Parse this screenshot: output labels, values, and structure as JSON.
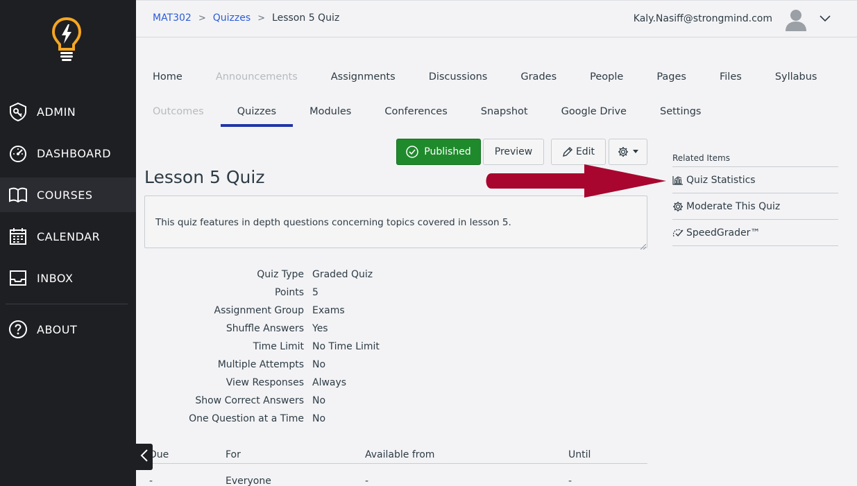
{
  "sidebar": {
    "items": [
      {
        "label": "ADMIN",
        "icon": "shield-key-icon"
      },
      {
        "label": "DASHBOARD",
        "icon": "speedometer-icon"
      },
      {
        "label": "COURSES",
        "icon": "book-icon"
      },
      {
        "label": "CALENDAR",
        "icon": "calendar-icon"
      },
      {
        "label": "INBOX",
        "icon": "inbox-icon"
      },
      {
        "label": "ABOUT",
        "icon": "question-circle-icon"
      }
    ],
    "active": "COURSES"
  },
  "breadcrumb": {
    "course": "MAT302",
    "section": "Quizzes",
    "current": "Lesson 5 Quiz"
  },
  "user": {
    "email": "Kaly.Nasiff@strongmind.com"
  },
  "tabs_row1": [
    "Home",
    "Announcements",
    "Assignments",
    "Discussions",
    "Grades",
    "People",
    "Pages",
    "Files",
    "Syllabus"
  ],
  "tabs_row2": [
    "Outcomes",
    "Quizzes",
    "Modules",
    "Conferences",
    "Snapshot",
    "Google Drive",
    "Settings"
  ],
  "toolbar": {
    "published_label": "Published",
    "preview_label": "Preview",
    "edit_label": "Edit"
  },
  "quiz": {
    "title": "Lesson 5 Quiz",
    "description": "This quiz features in depth questions concerning topics covered in lesson 5.",
    "details": [
      {
        "label": "Quiz Type",
        "value": "Graded Quiz"
      },
      {
        "label": "Points",
        "value": "5"
      },
      {
        "label": "Assignment Group",
        "value": "Exams"
      },
      {
        "label": "Shuffle Answers",
        "value": "Yes"
      },
      {
        "label": "Time Limit",
        "value": "No Time Limit"
      },
      {
        "label": "Multiple Attempts",
        "value": "No"
      },
      {
        "label": "View Responses",
        "value": "Always"
      },
      {
        "label": "Show Correct Answers",
        "value": "No"
      },
      {
        "label": "One Question at a Time",
        "value": "No"
      }
    ]
  },
  "due_table": {
    "headers": [
      "Due",
      "For",
      "Available from",
      "Until"
    ],
    "rows": [
      [
        "-",
        "Everyone",
        "-",
        "-"
      ]
    ]
  },
  "related": {
    "heading": "Related Items",
    "items": [
      {
        "label": "Quiz Statistics",
        "icon": "bar-chart-icon"
      },
      {
        "label": "Moderate This Quiz",
        "icon": "gear-icon"
      },
      {
        "label": "SpeedGrader™",
        "icon": "speedgrader-icon"
      }
    ]
  },
  "colors": {
    "sidebar_bg": "#1e1f23",
    "link": "#2a5bd7",
    "published": "#1f8a2c",
    "tab_active": "#1f35a8",
    "arrow": "#a8062f",
    "logo": "#f5a623"
  }
}
